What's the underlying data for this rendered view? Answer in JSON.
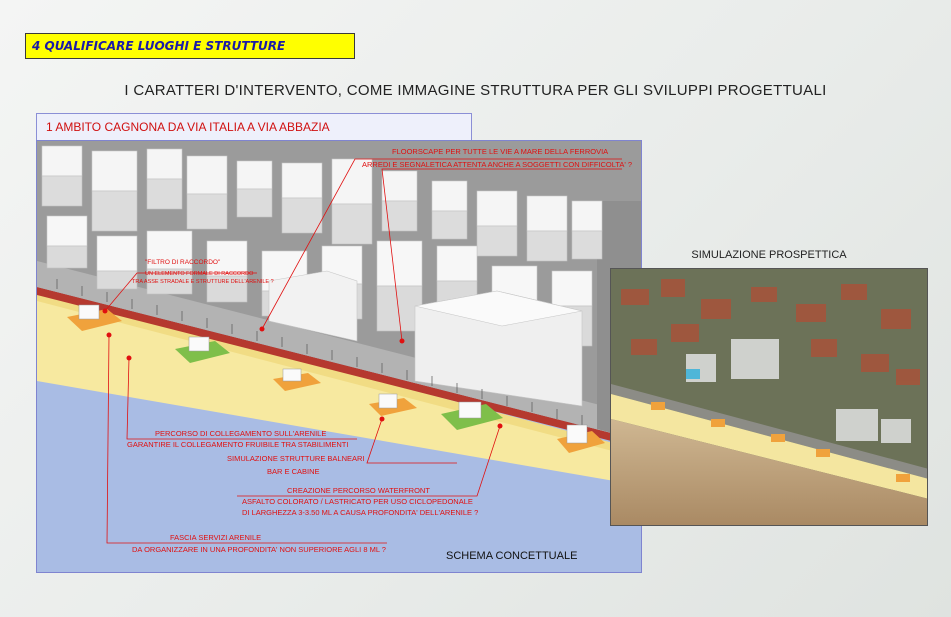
{
  "section_tag": "4  QUALIFICARE LUOGHI E STRUTTURE",
  "main_title": "I CARATTERI D'INTERVENTO, COME IMMAGINE STRUTTURA PER GLI SVILUPPI PROGETTUALI",
  "ambito_label": "1 AMBITO CAGNONA DA VIA ITALIA A VIA ABBAZIA",
  "annotations": {
    "floorscape_line1": "FLOORSCAPE PER TUTTE LE VIE A MARE DELLA FERROVIA",
    "floorscape_line2": "ARREDI E SEGNALETICA ATTENTA ANCHE A SOGGETTI CON DIFFICOLTA' ?",
    "filtro_title": "\"FILTRO DI RACCORDO\"",
    "filtro_line1": "UN ELEMENTO FORMALE DI RACCORDO",
    "filtro_line2": "TRA ASSE STRADALE E STRUTTURE DELL'ARENILE ?",
    "percorso_line1": "PERCORSO DI COLLEGAMENTO SULL'ARENILE",
    "percorso_line2": "GARANTIRE IL COLLEGAMENTO FRUIBILE TRA STABILIMENTI",
    "simulazione_line1": "SIMULAZIONE STRUTTURE BALNEARI",
    "simulazione_line2": "BAR E CABINE",
    "waterfront_line1": "CREAZIONE PERCORSO WATERFRONT",
    "waterfront_line2": "ASFALTO COLORATO / LASTRICATO PER USO CICLOPEDONALE",
    "waterfront_line3": "DI LARGHEZZA 3-3.50 ML  A CAUSA  PROFONDITA' DELL'ARENILE ?",
    "fascia_line1": "FASCIA SERVIZI ARENILE",
    "fascia_line2": "DA ORGANIZZARE IN UNA PROFONDITA' NON SUPERIORE AGLI 8 ML ?"
  },
  "schema_label": "SCHEMA CONCETTUALE",
  "photo_title": "SIMULAZIONE PROSPETTICA",
  "colors": {
    "tag_bg": "#ffff00",
    "tag_text": "#1a1aa8",
    "annotation": "#e01010",
    "sea": "#a9bce4",
    "beach": "#f7e9a0",
    "buildings": "#f4f4f4",
    "ground": "#9a9a9a"
  }
}
